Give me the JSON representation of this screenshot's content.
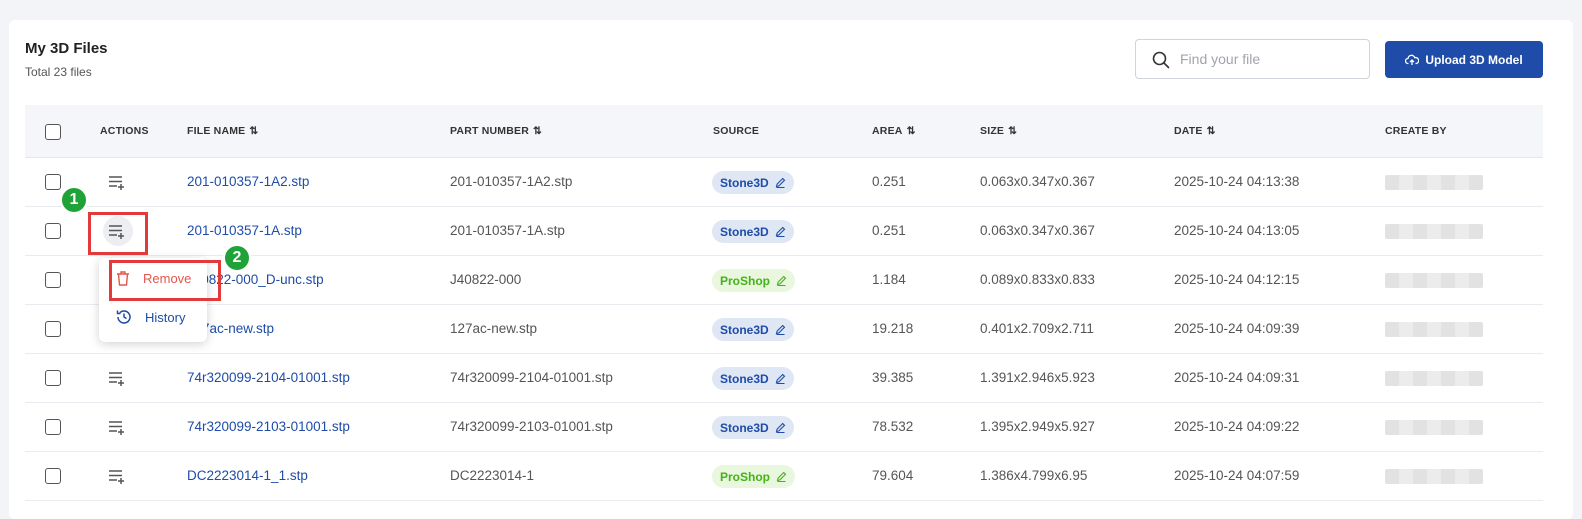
{
  "header": {
    "title": "My 3D Files",
    "subtitle": "Total 23 files"
  },
  "search": {
    "placeholder": "Find your file"
  },
  "upload_button": {
    "label": "Upload 3D Model"
  },
  "columns": {
    "actions": "ACTIONS",
    "file_name": "FILE NAME",
    "part_number": "PART NUMBER",
    "source": "SOURCE",
    "area": "AREA",
    "size": "SIZE",
    "date": "DATE",
    "create_by": "CREATE BY"
  },
  "rows": [
    {
      "file_name": "201-010357-1A2.stp",
      "part_number": "201-010357-1A2.stp",
      "source": "Stone3D",
      "area": "0.251",
      "size": "0.063x0.347x0.367",
      "date": "2025-10-24 04:13:38"
    },
    {
      "file_name": "201-010357-1A.stp",
      "part_number": "201-010357-1A.stp",
      "source": "Stone3D",
      "area": "0.251",
      "size": "0.063x0.347x0.367",
      "date": "2025-10-24 04:13:05"
    },
    {
      "file_name": "J40822-000_D-unc.stp",
      "part_number": "J40822-000",
      "source": "ProShop",
      "area": "1.184",
      "size": "0.089x0.833x0.833",
      "date": "2025-10-24 04:12:15"
    },
    {
      "file_name": "127ac-new.stp",
      "part_number": "127ac-new.stp",
      "source": "Stone3D",
      "area": "19.218",
      "size": "0.401x2.709x2.711",
      "date": "2025-10-24 04:09:39"
    },
    {
      "file_name": "74r320099-2104-01001.stp",
      "part_number": "74r320099-2104-01001.stp",
      "source": "Stone3D",
      "area": "39.385",
      "size": "1.391x2.946x5.923",
      "date": "2025-10-24 04:09:31"
    },
    {
      "file_name": "74r320099-2103-01001.stp",
      "part_number": "74r320099-2103-01001.stp",
      "source": "Stone3D",
      "area": "78.532",
      "size": "1.395x2.949x5.927",
      "date": "2025-10-24 04:09:22"
    },
    {
      "file_name": "DC2223014-1_1.stp",
      "part_number": "DC2223014-1",
      "source": "ProShop",
      "area": "79.604",
      "size": "1.386x4.799x6.95",
      "date": "2025-10-24 04:07:59"
    }
  ],
  "context_menu": {
    "remove": "Remove",
    "history": "History"
  },
  "annotations": {
    "step1": "1",
    "step2": "2"
  },
  "colors": {
    "primary": "#1e4ca8",
    "remove_red": "#e2574c",
    "proshop_green": "#43b317",
    "highlight_red": "#e23a3a",
    "step_green": "#1fa338"
  }
}
